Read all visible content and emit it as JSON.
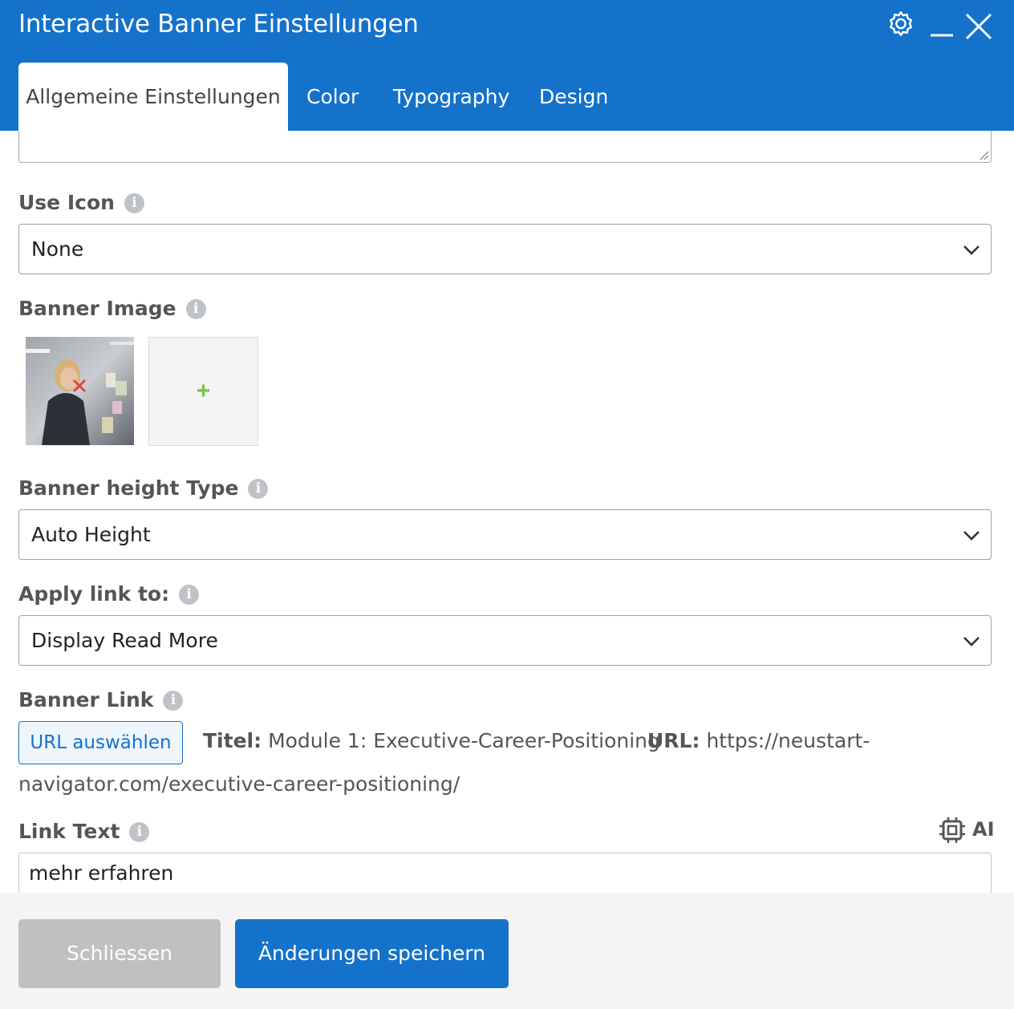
{
  "window": {
    "title": "Interactive Banner Einstellungen"
  },
  "tabs": [
    {
      "label": "Allgemeine Einstellungen",
      "active": true
    },
    {
      "label": "Color",
      "active": false
    },
    {
      "label": "Typography",
      "active": false
    },
    {
      "label": "Design",
      "active": false
    }
  ],
  "fields": {
    "use_icon": {
      "label": "Use Icon",
      "value": "None"
    },
    "banner_image": {
      "label": "Banner Image",
      "add_glyph": "+"
    },
    "banner_height": {
      "label": "Banner height Type",
      "value": "Auto Height"
    },
    "apply_link": {
      "label": "Apply link to:",
      "value": "Display Read More"
    },
    "banner_link": {
      "label": "Banner Link",
      "button": "URL auswählen",
      "title_label": "Titel:",
      "title_value": "Module 1: Executive-Career-Positioning",
      "url_label": "URL:",
      "url_part1": "https://neustart-",
      "url_part2": "navigator.com/executive-career-positioning/"
    },
    "link_text": {
      "label": "Link Text",
      "value": "mehr erfahren",
      "ai_label": "AI"
    }
  },
  "info_glyph": "i",
  "footer": {
    "close_label": "Schliessen",
    "save_label": "Änderungen speichern"
  },
  "icons": {
    "settings": "gear-icon",
    "minimize": "minimize-icon",
    "close": "close-icon",
    "info": "info-icon",
    "chevron": "chevron-down-icon",
    "ai": "chip-icon",
    "remove": "remove-image-icon"
  },
  "colors": {
    "header": "#1472cb",
    "primary_button": "#1472cb",
    "disabled_button": "#c0c0c0",
    "add_plus": "#7cc24a",
    "remove_x": "#e04646"
  }
}
